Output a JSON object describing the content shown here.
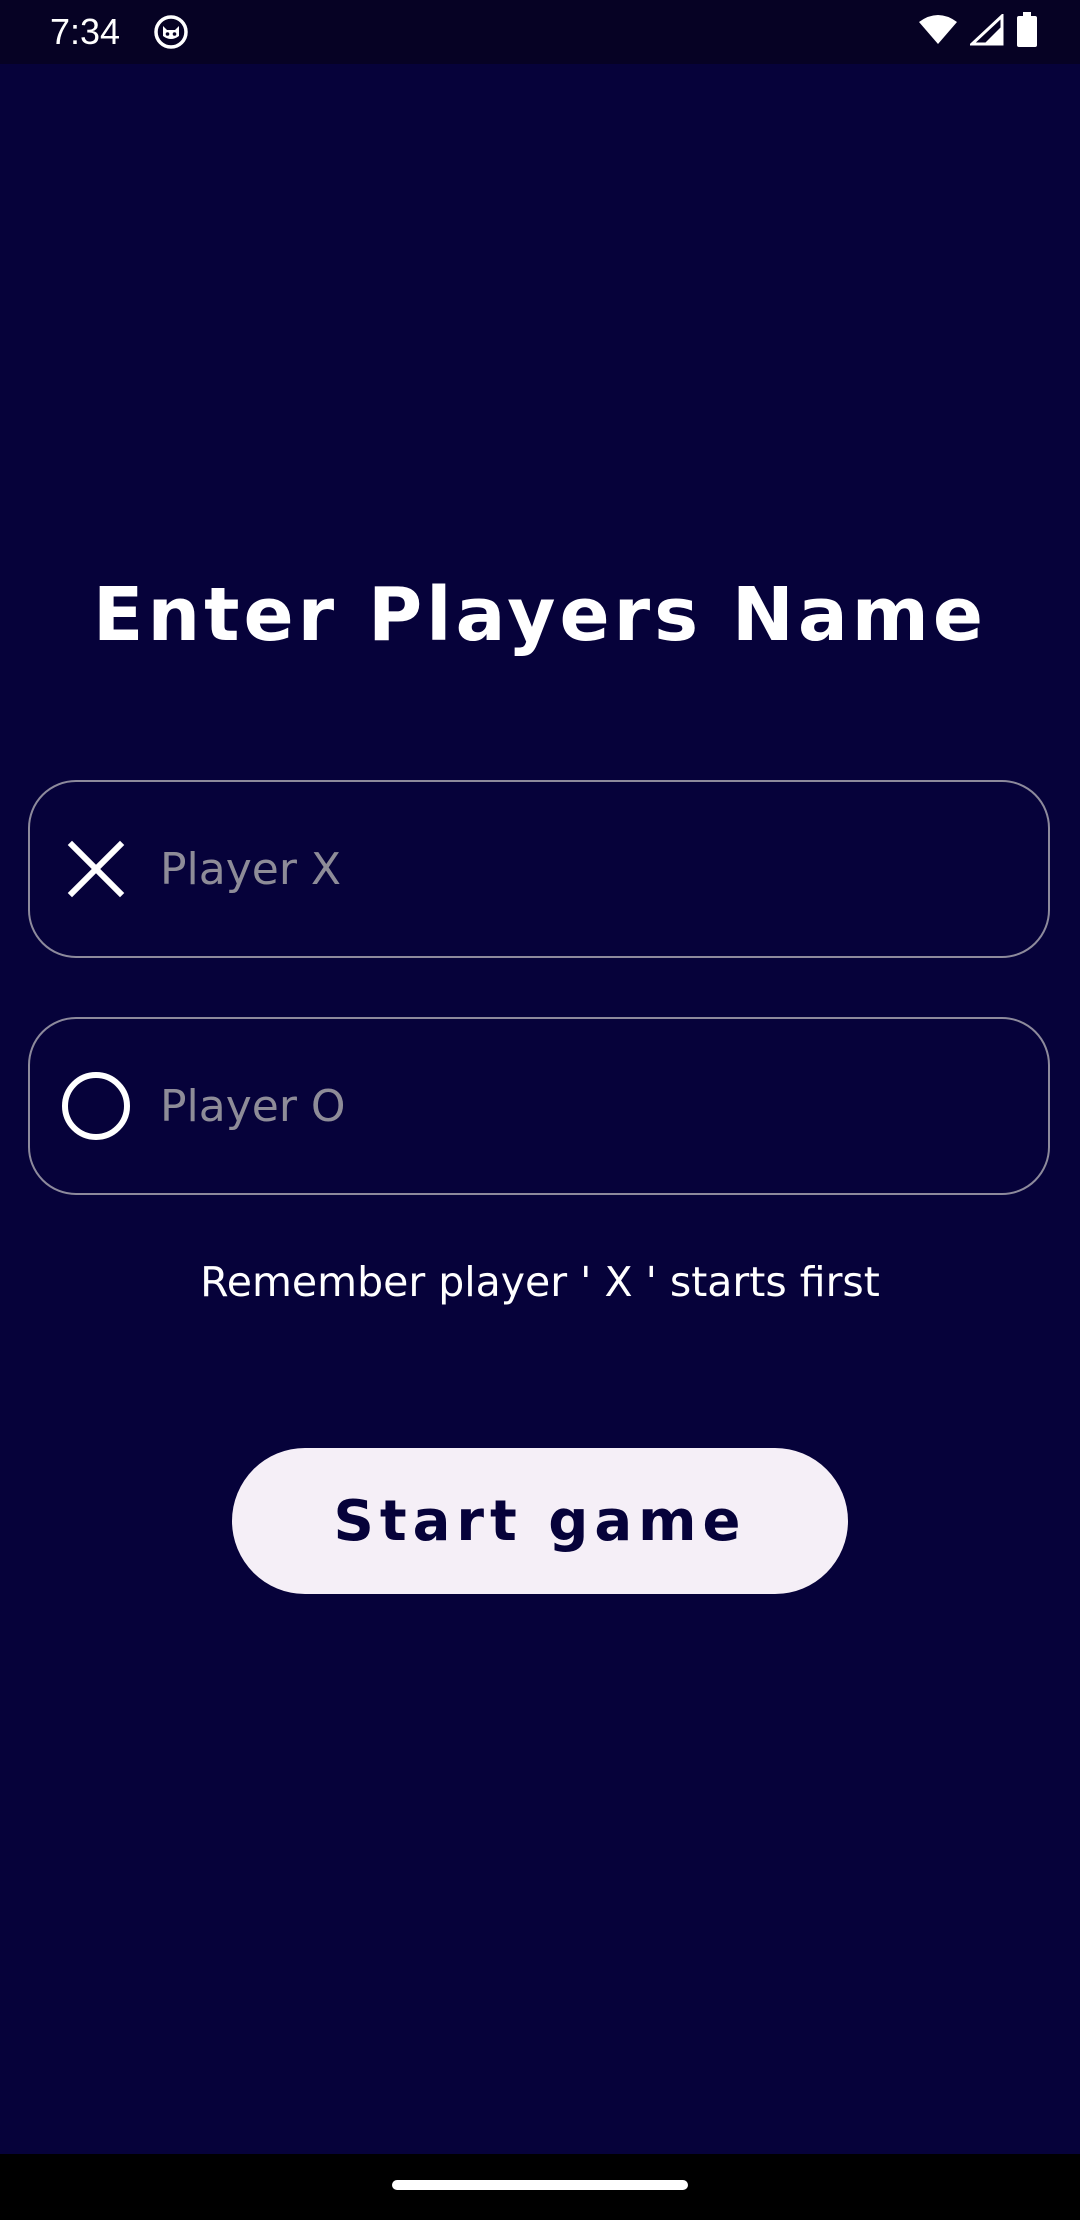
{
  "status_bar": {
    "time": "7:34",
    "icons": [
      "app-notification-icon",
      "wifi-icon",
      "cellular-signal-icon",
      "battery-icon"
    ]
  },
  "screen": {
    "title": "Enter Players Name",
    "player_x": {
      "icon": "x-icon",
      "placeholder": "Player X",
      "value": ""
    },
    "player_o": {
      "icon": "o-icon",
      "placeholder": "Player O",
      "value": ""
    },
    "hint": "Remember player ' X ' starts first",
    "start_button_label": "Start game"
  },
  "colors": {
    "background": "#06023a",
    "status_bar": "#060224",
    "text": "#ffffff",
    "field_border": "#8d8a9c",
    "placeholder": "#8e8c98",
    "button_bg": "#f5eff7",
    "button_text": "#06023a"
  }
}
